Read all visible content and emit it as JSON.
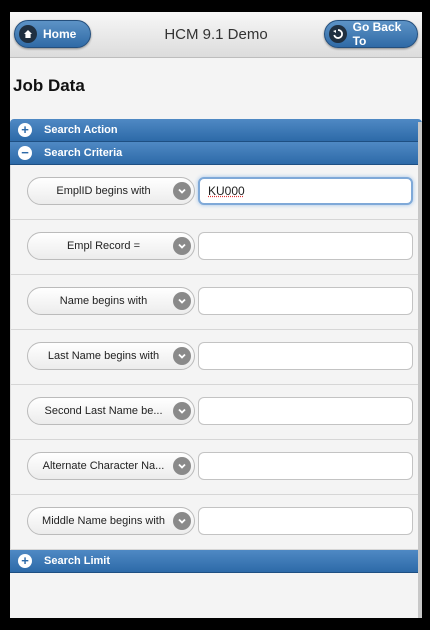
{
  "header": {
    "home_label": "Home",
    "title": "HCM 9.1 Demo",
    "back_label": "Go Back To"
  },
  "page": {
    "title": "Job Data"
  },
  "sections": {
    "search_action": "Search Action",
    "search_criteria": "Search Criteria",
    "search_limit": "Search Limit"
  },
  "criteria": [
    {
      "label": "EmplID begins with",
      "value": "KU000"
    },
    {
      "label": "Empl Record =",
      "value": ""
    },
    {
      "label": "Name begins with",
      "value": ""
    },
    {
      "label": "Last Name begins with",
      "value": ""
    },
    {
      "label": "Second Last Name be...",
      "value": ""
    },
    {
      "label": "Alternate Character Na...",
      "value": ""
    },
    {
      "label": "Middle Name begins with",
      "value": ""
    }
  ],
  "icons": {
    "plus": "+",
    "minus": "−"
  }
}
